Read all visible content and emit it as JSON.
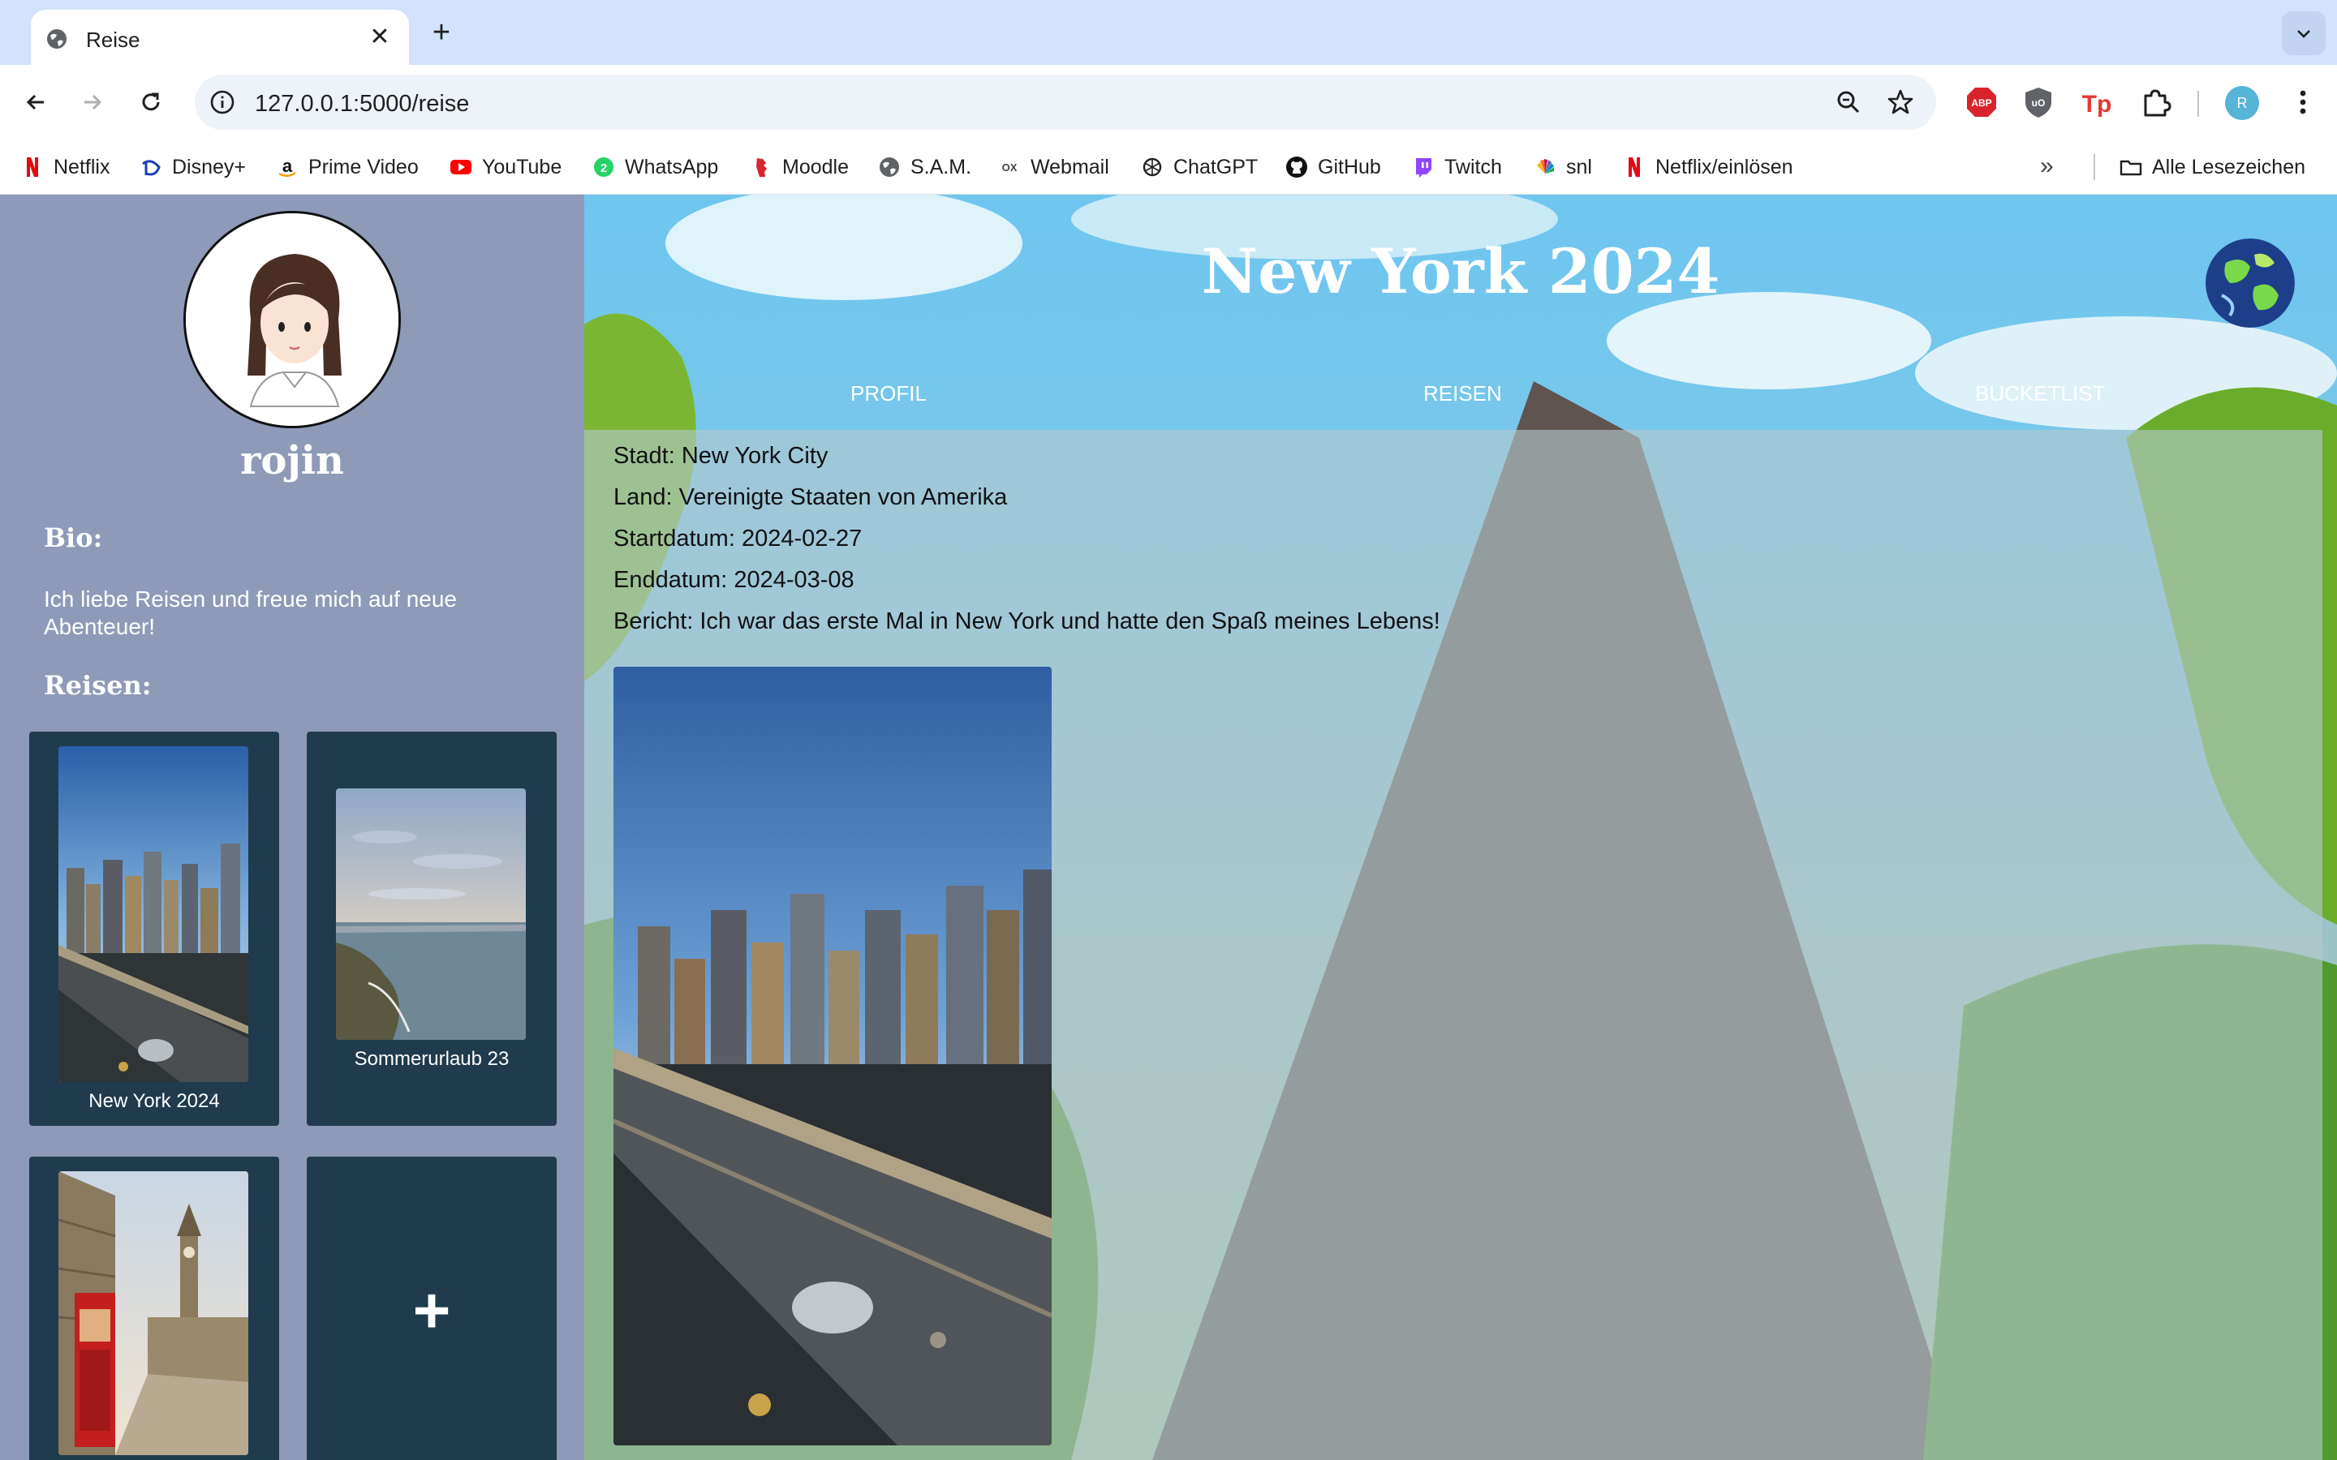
{
  "browser": {
    "tab_title": "Reise",
    "url": "127.0.0.1:5000/reise",
    "profile_initial": "R",
    "bookmarks": [
      "Netflix",
      "Disney+",
      "Prime Video",
      "YouTube",
      "WhatsApp",
      "Moodle",
      "S.A.M.",
      "Webmail",
      "ChatGPT",
      "GitHub",
      "Twitch",
      "snl",
      "Netflix/einlösen"
    ],
    "all_bookmarks": "Alle Lesezeichen"
  },
  "sidebar": {
    "username": "rojin",
    "bio_heading": "Bio:",
    "bio_text": "Ich liebe Reisen und freue mich auf neue Abenteuer!",
    "trips_heading": "Reisen:",
    "trips": [
      "New York 2024",
      "Sommerurlaub 23"
    ],
    "add_symbol": "+"
  },
  "main": {
    "title": "New York 2024",
    "nav": [
      "PROFIL",
      "REISEN",
      "BUCKETLIST"
    ],
    "details": [
      "Stadt: New York City",
      "Land: Vereinigte Staaten von Amerika",
      "Startdatum: 2024-02-27",
      "Enddatum: 2024-03-08",
      "Bericht: Ich war das erste Mal in New York und hatte den Spaß meines Lebens!"
    ]
  },
  "colors": {
    "sidebar_bg": "#8e9ab8",
    "card_bg": "#1f3b4d",
    "tabstrip_bg": "#d3e3fd"
  }
}
